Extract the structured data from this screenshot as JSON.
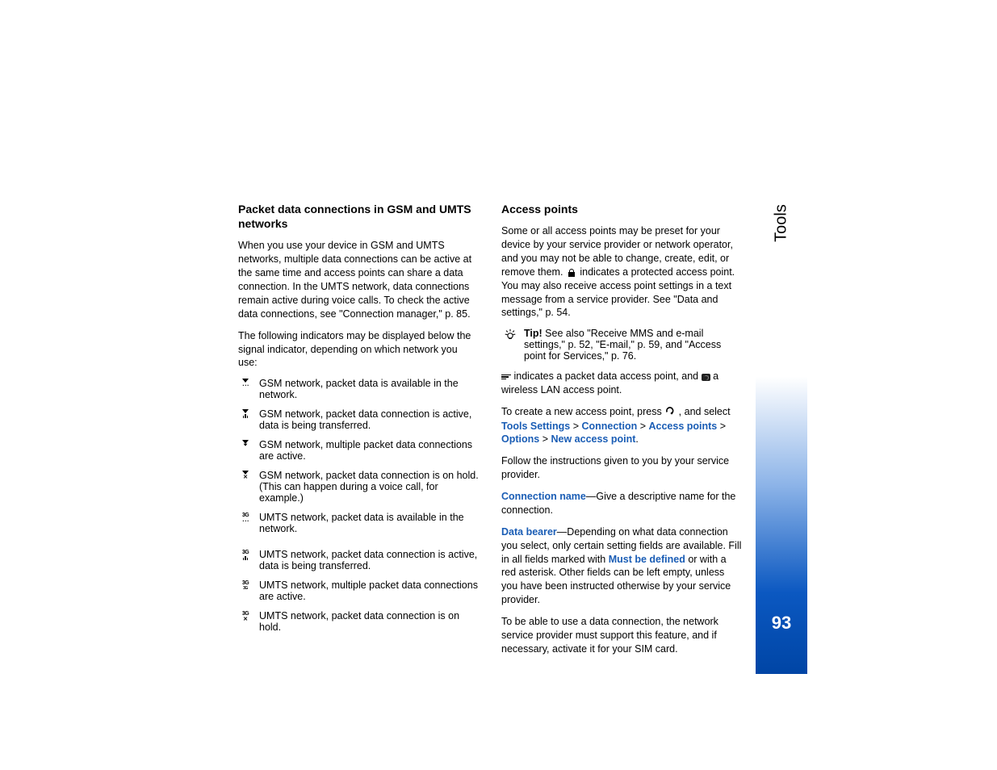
{
  "sidebar": {
    "label": "Tools",
    "page_number": "93"
  },
  "left": {
    "heading": "Packet data connections in GSM and UMTS networks",
    "p1": "When you use your device in GSM and UMTS networks, multiple data connections can be active at the same time and access points can share a data connection. In the UMTS network, data connections remain active during voice calls. To check the active data connections, see \"Connection manager,\" p. 85.",
    "p2": "The following indicators may be displayed below the signal indicator, depending on which network you use:",
    "items": [
      "GSM network, packet data is available in the network.",
      "GSM network, packet data connection is active, data is being transferred.",
      "GSM network, multiple packet data connections are active.",
      "GSM network, packet data connection is on hold. (This can happen during a voice call, for example.)",
      "UMTS network, packet data is available in the network.",
      "UMTS network, packet data connection is active, data is being transferred.",
      "UMTS network, multiple packet data connections are active.",
      "UMTS network, packet data connection is on hold."
    ]
  },
  "right": {
    "heading": "Access points",
    "p1a": "Some or all access points may be preset for your device by your service provider or network operator, and you may not be able to change, create, edit, or remove them. ",
    "p1b": " indicates a protected access point. You may also receive access point settings in a text message from a service provider. See \"Data and settings,\" p. 54.",
    "tip_label": "Tip!",
    "tip_text": " See also \"Receive MMS and e-mail settings,\" p. 52, \"E-mail,\" p. 59, and \"Access point for Services,\" p. 76.",
    "p2a": " indicates a packet data access point, and ",
    "p2b": " a wireless LAN access point.",
    "p3a": "To create a new access point, press ",
    "p3b": ", and select ",
    "nav": {
      "n1": "Tools",
      "n2": "Settings",
      "sep": " > ",
      "n3": "Connection",
      "n4": "Access points",
      "n5": "Options",
      "n6": "New access point",
      "end": "."
    },
    "p4": "Follow the instructions given to you by your service provider.",
    "conn_name_label": "Connection name",
    "conn_name_text": "—Give a descriptive name for the connection.",
    "data_bearer_label": "Data bearer",
    "data_bearer_text1": "—Depending on what data connection you select, only certain setting fields are available. Fill in all fields marked with ",
    "must_be_defined": "Must be defined",
    "data_bearer_text2": " or with a red asterisk. Other fields can be left empty, unless you have been instructed otherwise by your service provider.",
    "p5": "To be able to use a data connection, the network service provider must support this feature, and if necessary, activate it for your SIM card."
  }
}
